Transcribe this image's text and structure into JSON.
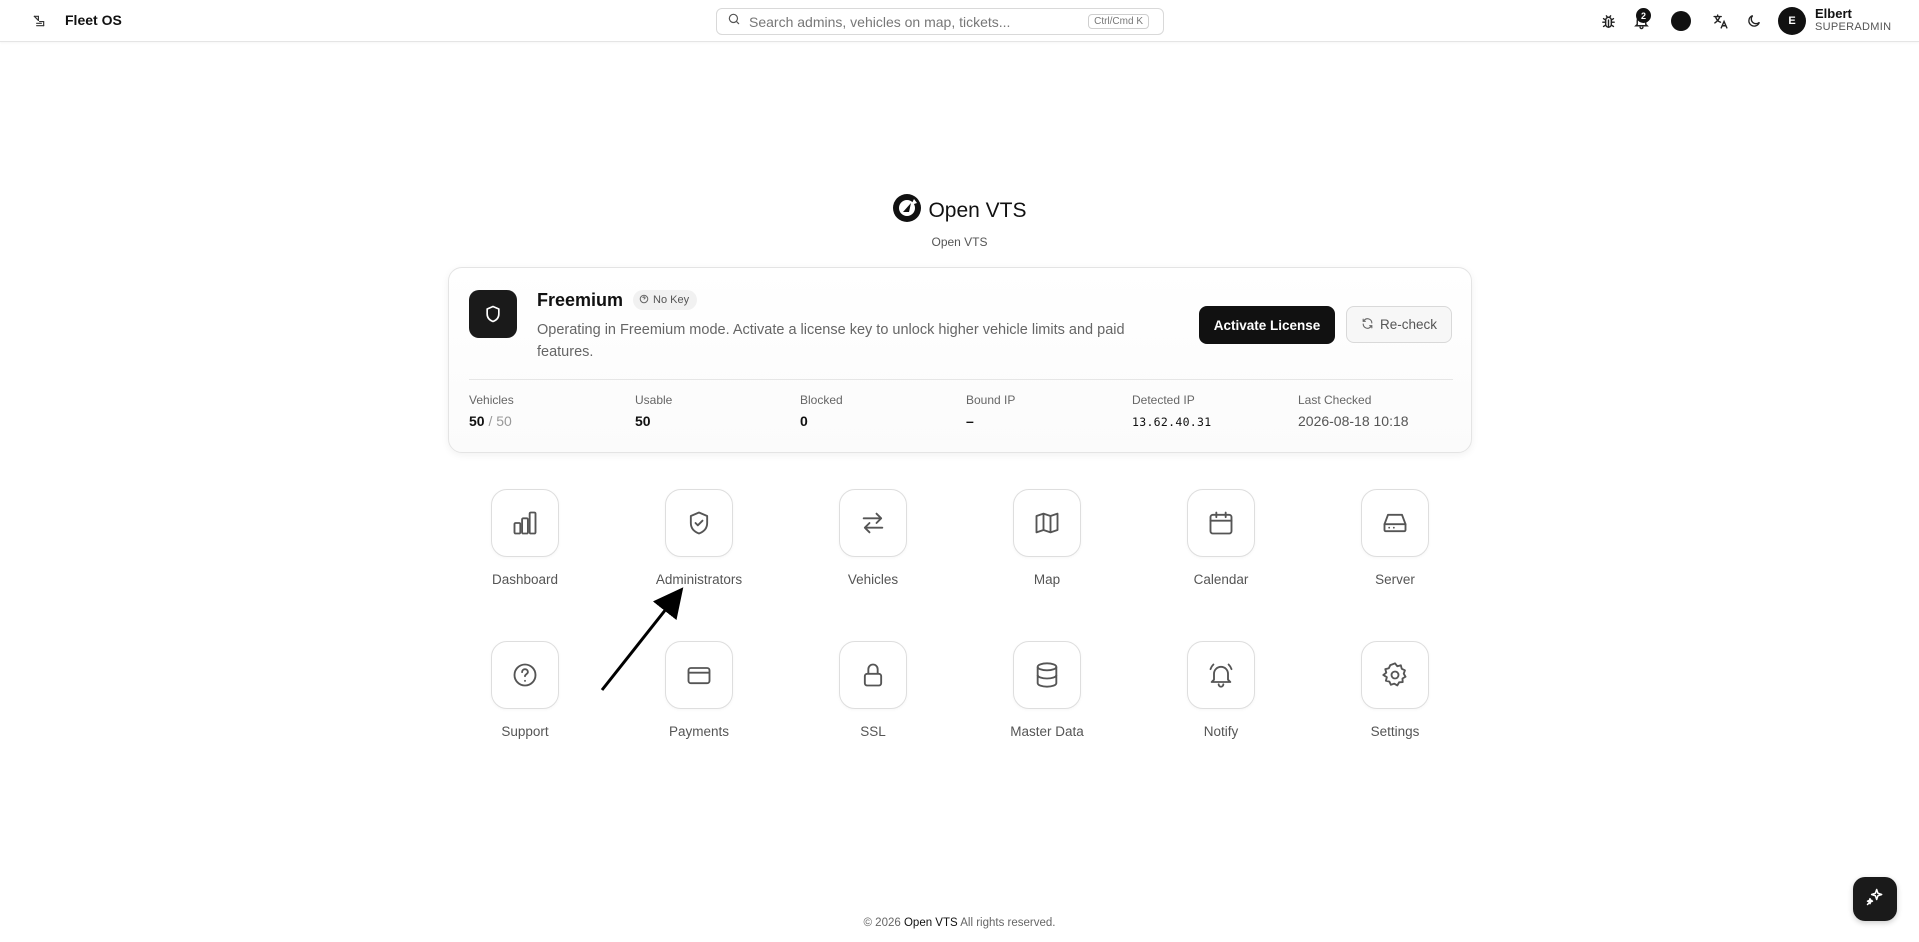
{
  "header": {
    "app_title": "Fleet OS",
    "search_placeholder": "Search admins, vehicles on map, tickets...",
    "search_shortcut": "Ctrl/Cmd K",
    "notification_count": "2",
    "user": {
      "initial": "E",
      "name": "Elbert",
      "role": "SUPERADMIN"
    },
    "icons": [
      "sidebar-toggle-icon",
      "bug-icon",
      "bell-icon",
      "theme-dot-icon",
      "translate-icon",
      "moon-icon"
    ]
  },
  "brand": {
    "name": "Open VTS",
    "subtitle": "Open VTS"
  },
  "license": {
    "plan": "Freemium",
    "key_status": "No Key",
    "description": "Operating in Freemium mode. Activate a license key to unlock higher vehicle limits and paid features.",
    "activate_label": "Activate License",
    "recheck_label": "Re-check",
    "stats": {
      "vehicles": {
        "label": "Vehicles",
        "used": "50",
        "total": "/ 50"
      },
      "usable": {
        "label": "Usable",
        "value": "50"
      },
      "blocked": {
        "label": "Blocked",
        "value": "0"
      },
      "bound_ip": {
        "label": "Bound IP",
        "value": "–"
      },
      "detected_ip": {
        "label": "Detected IP",
        "value": "13.62.40.31"
      },
      "last_checked": {
        "label": "Last Checked",
        "value": "2026-08-18 10:18"
      }
    }
  },
  "apps": [
    {
      "label": "Dashboard",
      "icon": "bar-chart-icon"
    },
    {
      "label": "Administrators",
      "icon": "shield-check-icon"
    },
    {
      "label": "Vehicles",
      "icon": "arrows-swap-icon"
    },
    {
      "label": "Map",
      "icon": "map-icon"
    },
    {
      "label": "Calendar",
      "icon": "calendar-icon"
    },
    {
      "label": "Server",
      "icon": "hard-drive-icon"
    },
    {
      "label": "Support",
      "icon": "help-circle-icon"
    },
    {
      "label": "Payments",
      "icon": "credit-card-icon"
    },
    {
      "label": "SSL",
      "icon": "lock-icon"
    },
    {
      "label": "Master Data",
      "icon": "database-icon"
    },
    {
      "label": "Notify",
      "icon": "bell-ring-icon"
    },
    {
      "label": "Settings",
      "icon": "gear-icon"
    }
  ],
  "footer": {
    "prefix": "© 2026",
    "brand": "Open VTS",
    "suffix": "All rights reserved."
  },
  "fab_icon": "sparkles-icon"
}
